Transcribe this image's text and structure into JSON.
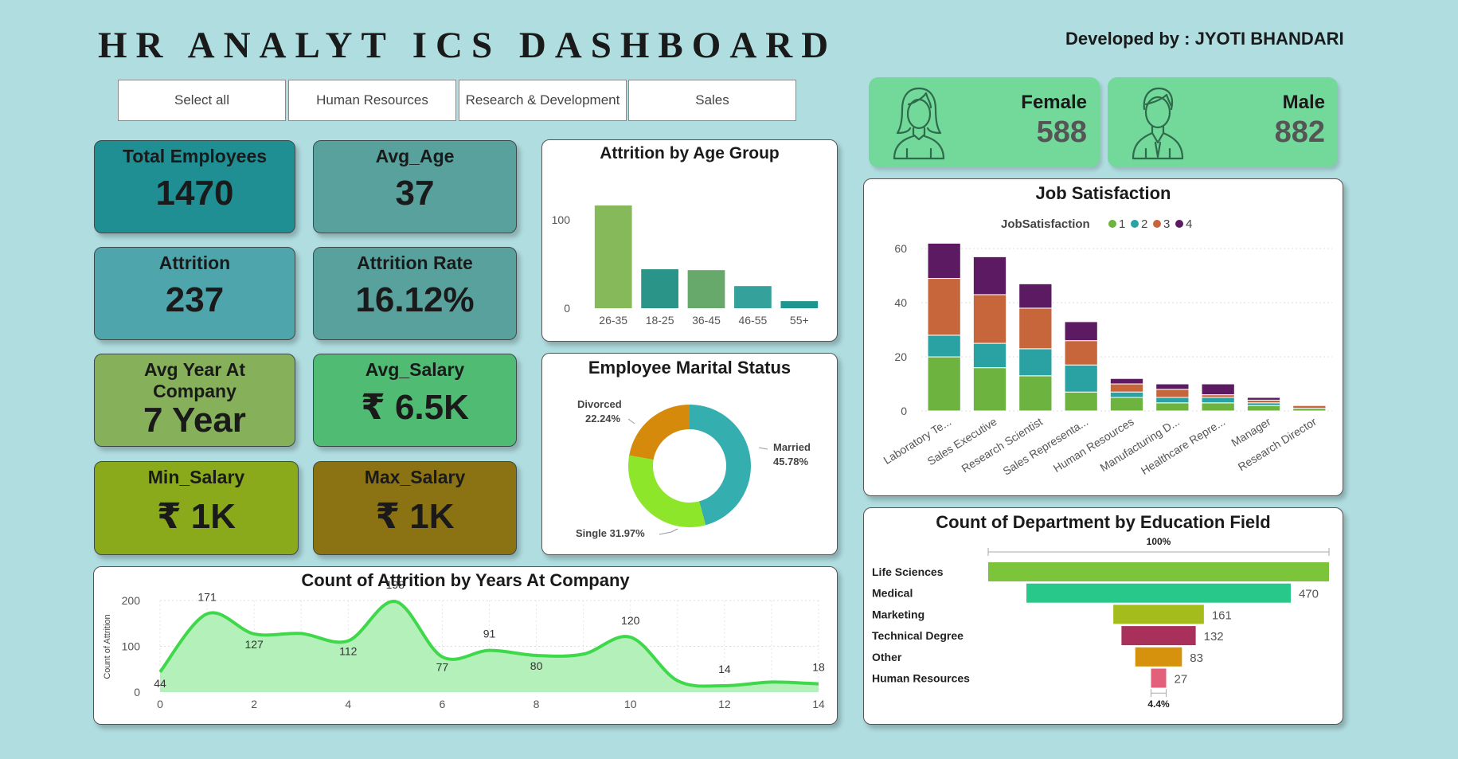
{
  "header": {
    "title": "HR ANALYT ICS DASHBOARD",
    "developer": "Developed by : JYOTI BHANDARI"
  },
  "slicers": [
    "Select all",
    "Human Resources",
    "Research & Development",
    "Sales"
  ],
  "kpis": {
    "total_employees": {
      "label": "Total Employees",
      "value": "1470"
    },
    "avg_age": {
      "label": "Avg_Age",
      "value": "37"
    },
    "attrition": {
      "label": "Attrition",
      "value": "237"
    },
    "attrition_rate": {
      "label": "Attrition Rate",
      "value": "16.12%"
    },
    "avg_year": {
      "label": "Avg Year At Company",
      "value": "7 Year"
    },
    "avg_salary": {
      "label": "Avg_Salary",
      "value": "₹ 6.5K"
    },
    "min_salary": {
      "label": "Min_Salary",
      "value": "₹ 1K"
    },
    "max_salary": {
      "label": "Max_Salary",
      "value": "₹ 1K"
    }
  },
  "gender": {
    "female": {
      "label": "Female",
      "value": "588",
      "icon": "female-user-icon"
    },
    "male": {
      "label": "Male",
      "value": "882",
      "icon": "male-user-icon"
    }
  },
  "colors": {
    "bg": "#b0dde0",
    "green_card": "#72d99b",
    "js1": "#6db33f",
    "js2": "#2aa1a3",
    "js3": "#c7663b",
    "js4": "#5c1a62"
  },
  "chart_data": [
    {
      "id": "age",
      "type": "bar",
      "title": "Attrition by Age Group",
      "categories": [
        "26-35",
        "18-25",
        "36-45",
        "46-55",
        "55+"
      ],
      "values": [
        116,
        44,
        43,
        25,
        8
      ],
      "colors": [
        "#86b95a",
        "#2a9489",
        "#66a96b",
        "#34a19a",
        "#1f958f"
      ],
      "yticks": [
        0,
        100
      ],
      "ylim": [
        0,
        125
      ]
    },
    {
      "id": "marital",
      "type": "pie",
      "title": "Employee Marital Status",
      "labels": [
        "Married",
        "Single",
        "Divorced"
      ],
      "values": [
        45.78,
        31.97,
        22.24
      ],
      "display": [
        "45.78%",
        "31.97%",
        "22.24%"
      ],
      "colors": [
        "#34aeae",
        "#8ee62a",
        "#d68a0c"
      ]
    },
    {
      "id": "years",
      "type": "area",
      "title": "Count of Attrition by Years At Company",
      "ylabel": "Count of Attrition",
      "x": [
        0,
        1,
        2,
        3,
        4,
        5,
        6,
        7,
        8,
        9,
        10,
        11,
        12,
        13,
        14
      ],
      "y": [
        44,
        171,
        127,
        128,
        112,
        198,
        77,
        91,
        80,
        83,
        120,
        25,
        14,
        22,
        18
      ],
      "labels": {
        "0": "44",
        "1": "171",
        "2": "127",
        "4": "112",
        "5": "198",
        "6": "77",
        "7": "91",
        "8": "80",
        "10": "120",
        "12": "14",
        "14": "18"
      },
      "xticks": [
        0,
        2,
        4,
        6,
        8,
        10,
        12,
        14
      ],
      "yticks": [
        0,
        100,
        200
      ],
      "ylim": [
        0,
        200
      ],
      "xlim": [
        0,
        14
      ]
    },
    {
      "id": "jobsat",
      "type": "bar",
      "stacked": true,
      "title": "Job Satisfaction",
      "legend_title": "JobSatisfaction",
      "categories": [
        "Laboratory Te...",
        "Sales Executive",
        "Research Scientist",
        "Sales Representa...",
        "Human Resources",
        "Manufacturing D...",
        "Healthcare Repre...",
        "Manager",
        "Research Director"
      ],
      "series": [
        {
          "name": "1",
          "values": [
            20,
            16,
            13,
            7,
            5,
            3,
            3,
            2,
            1
          ]
        },
        {
          "name": "2",
          "values": [
            8,
            9,
            10,
            10,
            2,
            2,
            2,
            1,
            0
          ]
        },
        {
          "name": "3",
          "values": [
            21,
            18,
            15,
            9,
            3,
            3,
            1,
            1,
            1
          ]
        },
        {
          "name": "4",
          "values": [
            13,
            14,
            9,
            7,
            2,
            2,
            4,
            1,
            0
          ]
        }
      ],
      "yticks": [
        0,
        20,
        40,
        60
      ],
      "ylim": [
        0,
        68
      ]
    },
    {
      "id": "edu",
      "type": "bar",
      "orientation": "funnel",
      "title": "Count of Department by Education Field",
      "categories": [
        "Life Sciences",
        "Medical",
        "Marketing",
        "Technical Degree",
        "Other",
        "Human Resources"
      ],
      "values": [
        606,
        470,
        161,
        132,
        83,
        27
      ],
      "display": [
        "",
        "470",
        "161",
        "132",
        "83",
        "27"
      ],
      "colors": [
        "#7cc43a",
        "#28c88a",
        "#a4bc1c",
        "#a8305a",
        "#d6920c",
        "#e2607a"
      ],
      "top_label": "100%",
      "bottom_label": "4.4%"
    }
  ]
}
